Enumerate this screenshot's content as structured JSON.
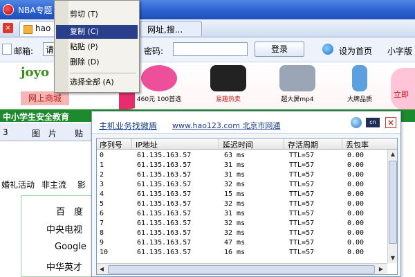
{
  "window": {
    "title": "NBA专题"
  },
  "tabs": {
    "tab1_label": "hao",
    "tab2_label": "网址,搜..."
  },
  "login": {
    "email_label": "邮箱:",
    "email_value": "请",
    "password_label": "密码:",
    "login_button": "登录",
    "set_home": "设为首页",
    "font_small": "小字版"
  },
  "ads": {
    "joyo_logo": "joyo",
    "joyo_sub": "网上商城",
    "items": [
      {
        "caption": "460元 100首选",
        "color": "#ee4f9a"
      },
      {
        "caption": "易趣热卖",
        "color": "#222222"
      },
      {
        "caption": "超大屏mp4",
        "color": "#9aa5b5"
      },
      {
        "caption": "大牌品质",
        "color": "#5ca0e0"
      }
    ],
    "right_label": "立即"
  },
  "page": {
    "green_banner": "中小学生安全教育",
    "tab_row": [
      "3",
      "图　片",
      "贴"
    ],
    "side_links": [
      "婚礼活动",
      "非主流",
      "影"
    ],
    "link_box": [
      "百　度",
      "中央电视",
      "Google",
      "中华英才"
    ]
  },
  "context_menu": {
    "items": [
      {
        "label": "剪切 (T)",
        "selected": false
      },
      {
        "label": "复制 (C)",
        "selected": true
      },
      {
        "label": "粘贴 (P)",
        "selected": false
      },
      {
        "label": "删除 (D)",
        "selected": false
      },
      {
        "label": "选择全部 (A)",
        "selected": false
      }
    ]
  },
  "dialog": {
    "link_main": "主机业务找微盾",
    "link_site": "www.hao123.com 北京市网通",
    "icon_b_text": "cn",
    "icon_c_text": "×",
    "columns": [
      "序列号",
      "IP地址",
      "延迟时间",
      "存活周期",
      "丢包率"
    ],
    "rows": [
      {
        "seq": "0",
        "ip": "61.135.163.57",
        "delay": "63 ms",
        "ttl": "TTL=57",
        "loss": "0.00"
      },
      {
        "seq": "1",
        "ip": "61.135.163.57",
        "delay": "31 ms",
        "ttl": "TTL=57",
        "loss": "0.00"
      },
      {
        "seq": "2",
        "ip": "61.135.163.57",
        "delay": "31 ms",
        "ttl": "TTL=57",
        "loss": "0.00"
      },
      {
        "seq": "3",
        "ip": "61.135.163.57",
        "delay": "32 ms",
        "ttl": "TTL=57",
        "loss": "0.00"
      },
      {
        "seq": "4",
        "ip": "61.135.163.57",
        "delay": "15 ms",
        "ttl": "TTL=57",
        "loss": "0.00"
      },
      {
        "seq": "5",
        "ip": "61.135.163.57",
        "delay": "32 ms",
        "ttl": "TTL=57",
        "loss": "0.00"
      },
      {
        "seq": "6",
        "ip": "61.135.163.57",
        "delay": "31 ms",
        "ttl": "TTL=57",
        "loss": "0.00"
      },
      {
        "seq": "7",
        "ip": "61.135.163.57",
        "delay": "32 ms",
        "ttl": "TTL=57",
        "loss": "0.00"
      },
      {
        "seq": "8",
        "ip": "61.135.163.57",
        "delay": "32 ms",
        "ttl": "TTL=57",
        "loss": "0.00"
      },
      {
        "seq": "9",
        "ip": "61.135.163.57",
        "delay": "47 ms",
        "ttl": "TTL=57",
        "loss": "0.00"
      },
      {
        "seq": "10",
        "ip": "61.135.163.57",
        "delay": "16 ms",
        "ttl": "TTL=57",
        "loss": "0.00"
      }
    ]
  }
}
